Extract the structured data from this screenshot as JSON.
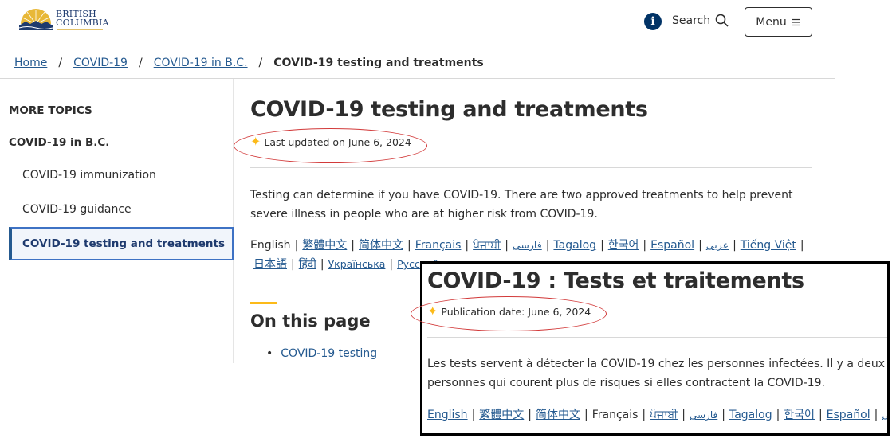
{
  "header": {
    "logo_line1": "BRITISH",
    "logo_line2": "COLUMBIA",
    "info_icon": "i",
    "search_label": "Search",
    "menu_label": "Menu"
  },
  "breadcrumb": {
    "items": [
      "Home",
      "COVID-19",
      "COVID-19 in B.C."
    ],
    "current": "COVID-19 testing and treatments",
    "separator": "/"
  },
  "sidebar": {
    "heading": "MORE TOPICS",
    "parent": "COVID-19 in B.C.",
    "items": [
      "COVID-19 immunization",
      "COVID-19 guidance"
    ],
    "active": "COVID-19 testing and treatments"
  },
  "main": {
    "title": "COVID-19 testing and treatments",
    "updated": "Last updated on June 6, 2024",
    "intro": "Testing can determine if you have COVID-19. There are two approved treatments to help prevent severe illness in people who are at higher risk from COVID-19.",
    "languages_current": "English",
    "languages": [
      "繁體中文",
      "简体中文",
      "Français",
      "ਪੰਜਾਬੀ",
      "فارسی",
      "Tagalog",
      "한국어",
      "Español",
      "عربى",
      "Tiếng Việt",
      "日本語",
      "हिंदी",
      "Українська",
      "Русский"
    ],
    "on_this_page_title": "On this page",
    "on_this_page_links": [
      "COVID-19 testing"
    ]
  },
  "french": {
    "title": "COVID-19 : Tests et traitements",
    "publication": "Publication date: June 6, 2024",
    "intro_line1": "Les tests servent à détecter la COVID-19 chez les personnes infectées. Il y a deux traitements",
    "intro_line2": "personnes qui courent plus de risques si elles contractent la COVID-19.",
    "languages": [
      "English",
      "繁體中文",
      "简体中文"
    ],
    "languages_current": "Français",
    "languages_after": [
      "ਪੰਜਾਬੀ",
      "فارسی",
      "Tagalog",
      "한국어",
      "Español",
      "عربى"
    ]
  },
  "colors": {
    "link": "#255a90",
    "accent_yellow": "#fcba19",
    "navy": "#013366",
    "annotation_red": "#d23a3a"
  }
}
